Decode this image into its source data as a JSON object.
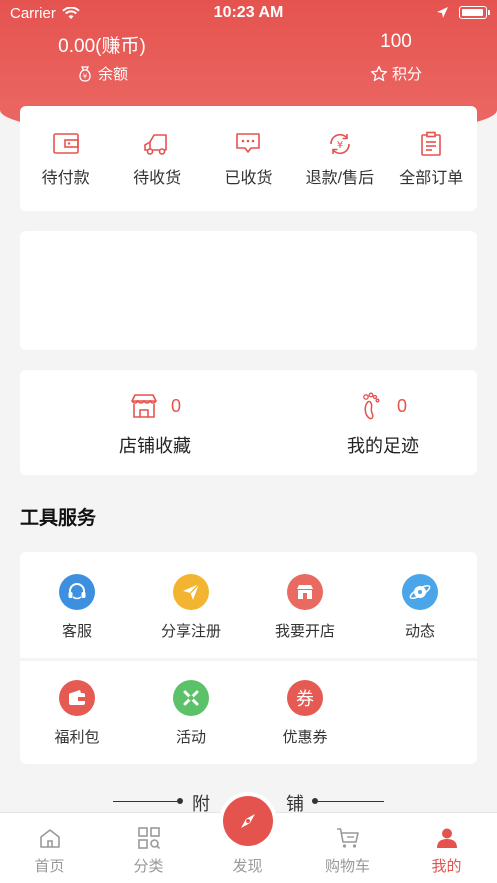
{
  "status_bar": {
    "carrier": "Carrier",
    "time": "10:23 AM"
  },
  "wallet": {
    "balance_value": "0.00(赚币)",
    "balance_label": "余额",
    "points_value": "100",
    "points_label": "积分"
  },
  "orders": [
    {
      "label": "待付款",
      "icon": "wallet-icon"
    },
    {
      "label": "待收货",
      "icon": "truck-icon"
    },
    {
      "label": "已收货",
      "icon": "message-box-icon"
    },
    {
      "label": "退款/售后",
      "icon": "refund-icon"
    },
    {
      "label": "全部订单",
      "icon": "clipboard-icon"
    }
  ],
  "favorites": {
    "shop_count": "0",
    "shop_label": "店铺收藏",
    "footprint_count": "0",
    "footprint_label": "我的足迹"
  },
  "tools": {
    "title": "工具服务",
    "items": [
      {
        "label": "客服",
        "icon": "headset-icon",
        "color": "#3d8fe0"
      },
      {
        "label": "分享注册",
        "icon": "paper-plane-icon",
        "color": "#f2b431"
      },
      {
        "label": "我要开店",
        "icon": "store-icon",
        "color": "#e86a60"
      },
      {
        "label": "动态",
        "icon": "planet-icon",
        "color": "#4aa6e8"
      },
      {
        "label": "福利包",
        "icon": "wallet-icon",
        "color": "#e55a52"
      },
      {
        "label": "活动",
        "icon": "cross-icon",
        "color": "#5cc26a"
      },
      {
        "label": "优惠券",
        "icon": "coupon-icon",
        "color": "#e55a52",
        "glyph": "券"
      }
    ]
  },
  "nearby": {
    "left_char": "附",
    "right_char": "铺"
  },
  "tabbar": [
    {
      "label": "首页",
      "icon": "home-icon"
    },
    {
      "label": "分类",
      "icon": "category-icon"
    },
    {
      "label": "发现",
      "icon": "compass-icon"
    },
    {
      "label": "购物车",
      "icon": "cart-icon"
    },
    {
      "label": "我的",
      "icon": "user-icon",
      "active": true
    }
  ],
  "colors": {
    "brand": "#e5534f",
    "background": "#f4f4f4"
  }
}
